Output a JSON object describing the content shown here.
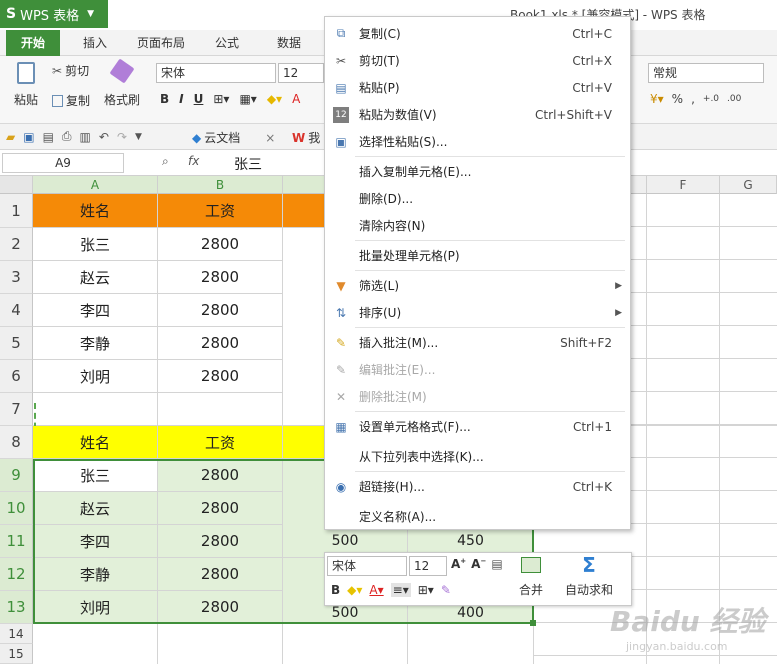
{
  "app": {
    "name": "WPS 表格",
    "logo": "S",
    "doc_title": "Book1.xls * [兼容模式] - WPS 表格"
  },
  "tabs": [
    "开始",
    "插入",
    "页面布局",
    "公式",
    "数据"
  ],
  "ribbon": {
    "paste_label": "粘贴",
    "cut_label": "剪切",
    "copy_label": "复制",
    "format_painter_label": "格式刷",
    "font_name": "宋体",
    "font_size": "12",
    "number_format": "常规"
  },
  "qat": {
    "cloud_docs": "云文档",
    "my_label": "我"
  },
  "formula_bar": {
    "name_box": "A9",
    "fx": "fx",
    "value": "张三"
  },
  "sheet": {
    "columns": [
      "A",
      "B",
      "",
      "",
      "",
      "F",
      "G"
    ],
    "rows": [
      "1",
      "2",
      "3",
      "4",
      "5",
      "6",
      "7",
      "8",
      "9",
      "10",
      "11",
      "12",
      "13",
      "14",
      "15"
    ],
    "table1": {
      "header": [
        "姓名",
        "工资"
      ],
      "rows": [
        [
          "张三",
          "2800"
        ],
        [
          "赵云",
          "2800"
        ],
        [
          "李四",
          "2800"
        ],
        [
          "李静",
          "2800"
        ],
        [
          "刘明",
          "2800"
        ]
      ]
    },
    "table2": {
      "header": [
        "姓名",
        "工资"
      ],
      "rows": [
        [
          "张三",
          "2800"
        ],
        [
          "赵云",
          "2800"
        ],
        [
          "李四",
          "2800"
        ],
        [
          "李静",
          "2800"
        ],
        [
          "刘明",
          "2800"
        ]
      ],
      "row11_extra": [
        "500",
        "450"
      ],
      "row13_extra": [
        "500",
        "400"
      ]
    }
  },
  "context_menu": [
    {
      "label": "复制(C)",
      "shortcut": "Ctrl+C",
      "icon": "copy-icon",
      "disabled": false
    },
    {
      "label": "剪切(T)",
      "shortcut": "Ctrl+X",
      "icon": "cut-icon",
      "disabled": false
    },
    {
      "label": "粘贴(P)",
      "shortcut": "Ctrl+V",
      "icon": "paste-icon",
      "disabled": false
    },
    {
      "label": "粘贴为数值(V)",
      "shortcut": "Ctrl+Shift+V",
      "icon": "paste-values-icon",
      "disabled": false
    },
    {
      "label": "选择性粘贴(S)...",
      "shortcut": "",
      "icon": "paste-special-icon",
      "disabled": false
    },
    {
      "label": "插入复制单元格(E)...",
      "shortcut": "",
      "icon": "",
      "disabled": false
    },
    {
      "label": "删除(D)...",
      "shortcut": "",
      "icon": "",
      "disabled": false
    },
    {
      "label": "清除内容(N)",
      "shortcut": "",
      "icon": "",
      "disabled": false
    },
    {
      "label": "批量处理单元格(P)",
      "shortcut": "",
      "icon": "",
      "disabled": false
    },
    {
      "label": "筛选(L)",
      "shortcut": "",
      "icon": "filter-icon",
      "disabled": false,
      "submenu": true
    },
    {
      "label": "排序(U)",
      "shortcut": "",
      "icon": "sort-icon",
      "disabled": false,
      "submenu": true
    },
    {
      "label": "插入批注(M)...",
      "shortcut": "Shift+F2",
      "icon": "insert-comment-icon",
      "disabled": false
    },
    {
      "label": "编辑批注(E)...",
      "shortcut": "",
      "icon": "edit-comment-icon",
      "disabled": true
    },
    {
      "label": "删除批注(M)",
      "shortcut": "",
      "icon": "delete-comment-icon",
      "disabled": true
    },
    {
      "label": "设置单元格格式(F)...",
      "shortcut": "Ctrl+1",
      "icon": "format-cells-icon",
      "disabled": false
    },
    {
      "label": "从下拉列表中选择(K)...",
      "shortcut": "",
      "icon": "",
      "disabled": false
    },
    {
      "label": "超链接(H)...",
      "shortcut": "Ctrl+K",
      "icon": "hyperlink-icon",
      "disabled": false
    },
    {
      "label": "定义名称(A)...",
      "shortcut": "",
      "icon": "",
      "disabled": false
    }
  ],
  "mini_toolbar": {
    "font_name": "宋体",
    "font_size": "12",
    "merge_label": "合并",
    "autosum_label": "自动求和"
  },
  "colors": {
    "brand_green": "#3f8f3a",
    "orange_header": "#f58a07",
    "yellow_header": "#ffff00",
    "selection_fill": "#e2f0d9"
  },
  "watermark": {
    "text": "Baidu 经验",
    "url_text": "jingyan.baidu.com"
  }
}
